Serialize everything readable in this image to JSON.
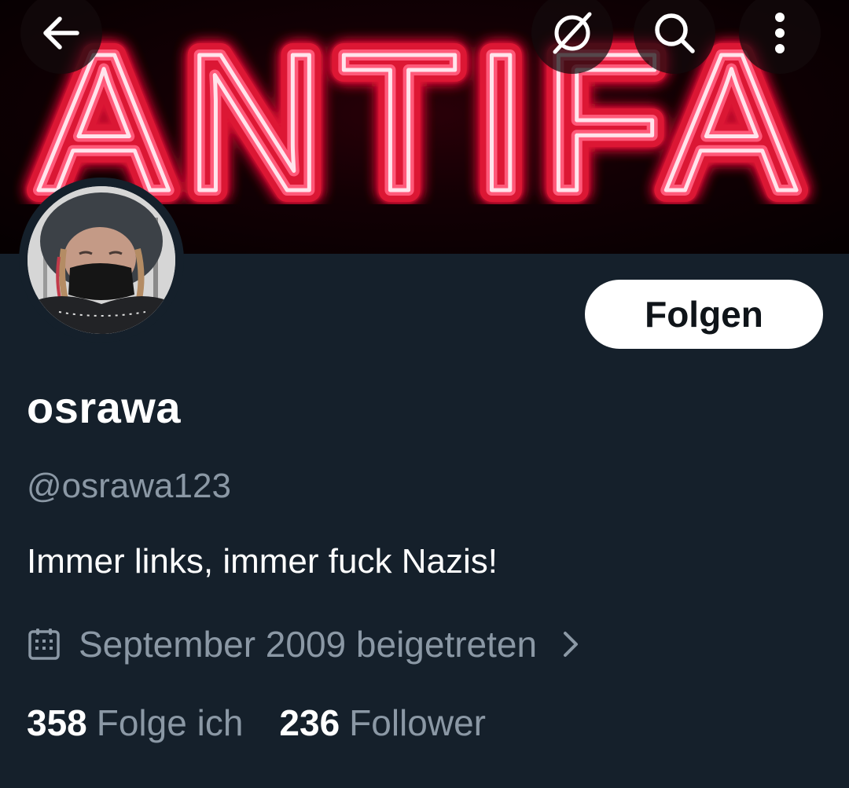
{
  "colors": {
    "background": "#15202b",
    "secondary_text": "#8b98a5",
    "primary_text": "#ffffff",
    "neon_glow": "#ff1a3c",
    "neon_core": "#ffd6e4",
    "follow_button_bg": "#ffffff"
  },
  "banner": {
    "text": "ANTIFA"
  },
  "topbar": {
    "back_icon": "arrow-left-icon",
    "lists_icon": "no-symbol-icon",
    "search_icon": "search-icon",
    "more_icon": "more-vertical-icon"
  },
  "profile": {
    "display_name": "osrawa",
    "handle": "@osrawa123",
    "bio": "Immer links, immer fuck Nazis!",
    "joined": "September 2009 beigetreten",
    "follow_label": "Folgen"
  },
  "stats": {
    "following_count": "358",
    "following_label": "Folge ich",
    "followers_count": "236",
    "followers_label": "Follower"
  }
}
